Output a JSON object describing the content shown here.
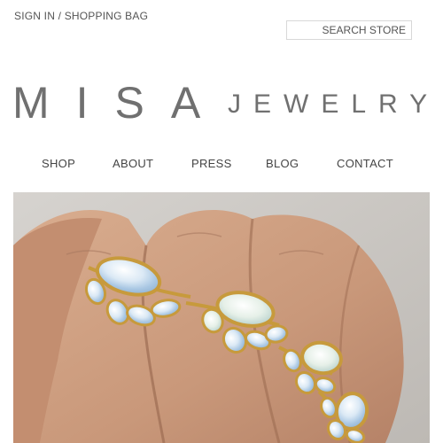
{
  "header": {
    "sign_in_label": "SIGN IN",
    "separator": " / ",
    "shopping_bag_label": "SHOPPING BAG"
  },
  "search": {
    "placeholder": "SEARCH STORE"
  },
  "logo": {
    "main": "MISA",
    "sub": "JEWELRY"
  },
  "nav": {
    "items": [
      {
        "label": "SHOP"
      },
      {
        "label": "ABOUT"
      },
      {
        "label": "PRESS"
      },
      {
        "label": "BLOG"
      },
      {
        "label": "CONTACT"
      }
    ]
  },
  "hero": {
    "icon": "opal-rings-photo",
    "colors": {
      "skin": "#cfa183",
      "skin_shadow": "#a5735a",
      "gold": "#c79a3c",
      "opal": "#dfeaf3",
      "background": "#c9c6c2"
    }
  }
}
